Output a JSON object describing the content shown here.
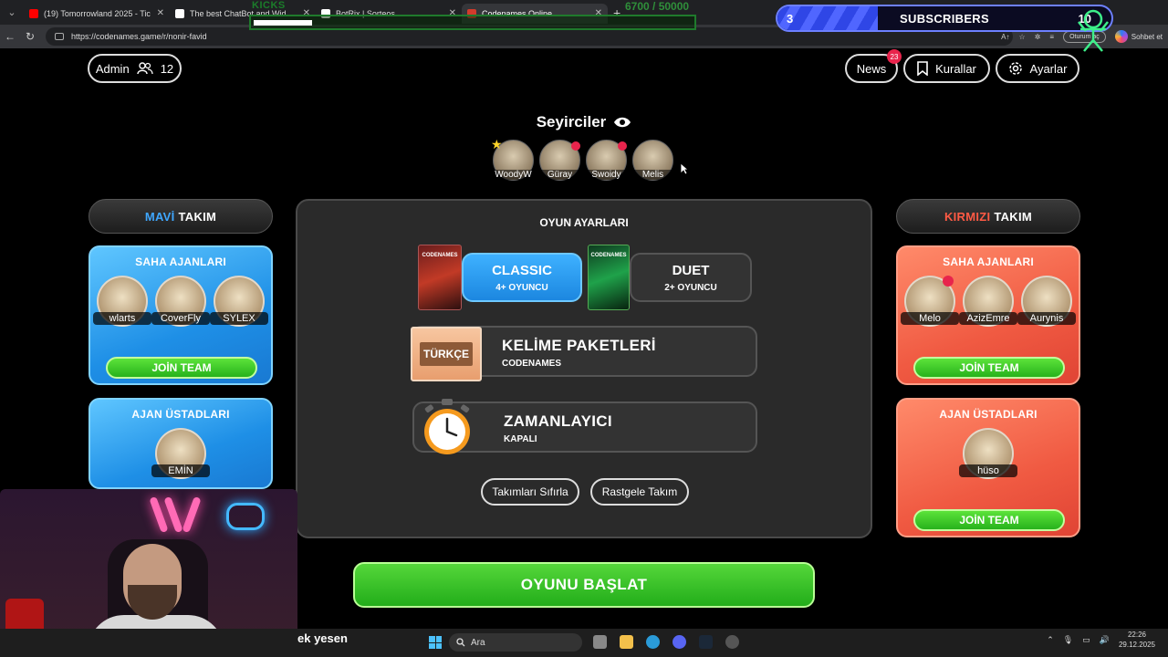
{
  "browser": {
    "tabs": [
      {
        "title": "(19) Tomorrowland 2025 - Tic",
        "color": "#ff0000",
        "active": false
      },
      {
        "title": "The best ChatBot and Widgets for",
        "color": "#ffffff",
        "active": false
      },
      {
        "title": "BotRix | Sorteos",
        "color": "#ffffff",
        "active": false
      },
      {
        "title": "Codenames Online",
        "color": "#d23b2c",
        "active": true
      }
    ],
    "url": "https://codenames.game/r/nonir-favid",
    "login_label": "Oturum aç",
    "chat_label": "Sohbet et"
  },
  "overlays": {
    "kicks_label": "KICKS",
    "kicks_progress": 0.134,
    "kicks_count": "6700  / 50000",
    "subs_current": "3",
    "subs_label": "SUBSCRIBERS",
    "subs_goal": "10",
    "subs_progress": 0.3
  },
  "header": {
    "admin_label": "Admin",
    "player_count": "12",
    "news_label": "News",
    "news_badge": "23",
    "rules_label": "Kurallar",
    "settings_label": "Ayarlar"
  },
  "spectators": {
    "title": "Seyirciler",
    "list": [
      {
        "name": "WoodyW"
      },
      {
        "name": "Güray"
      },
      {
        "name": "Swoidy"
      },
      {
        "name": "Melis"
      }
    ]
  },
  "blue_team": {
    "header_color_word": "MAVİ",
    "header_rest": "TAKIM",
    "operatives_title": "SAHA AJANLARI",
    "operatives": [
      "wlarts",
      "CoverFly",
      "SYLEX"
    ],
    "join_label": "JOİN TEAM",
    "spymasters_title": "AJAN ÜSTADLARI",
    "spymasters": [
      "EMİN"
    ]
  },
  "red_team": {
    "header_color_word": "KIRMIZI",
    "header_rest": "TAKIM",
    "operatives_title": "SAHA AJANLARI",
    "operatives": [
      "Melo",
      "AzizEmre",
      "Aurynis"
    ],
    "join_label": "JOİN TEAM",
    "spymasters_title": "AJAN ÜSTADLARI",
    "spymasters": [
      "hüso"
    ],
    "join_label_2": "JOİN TEAM"
  },
  "settings": {
    "title": "OYUN AYARLARI",
    "mode_classic": "CLASSIC",
    "mode_classic_sub": "4+ OYUNCU",
    "mode_duet": "DUET",
    "mode_duet_sub": "2+ OYUNCU",
    "box_label": "CODENAMES",
    "wordpack_title": "KELİME PAKETLERİ",
    "wordpack_sub": "CODENAMES",
    "wordpack_lang": "TÜRKÇE",
    "timer_title": "ZAMANLAYICI",
    "timer_sub": "KAPALI",
    "reset_teams": "Takımları Sıfırla",
    "random_teams": "Rastgele Takım"
  },
  "start_label": "OYUNU BAŞLAT",
  "taskbar": {
    "stream_text": "ek yesen",
    "search_placeholder": "Ara",
    "time": "22:26",
    "date": "29.12.2025"
  },
  "colors": {
    "blue_accent": "#3fa7ff",
    "red_accent": "#ff5a44",
    "join_green": "#27b21c",
    "badge_red": "#e8244c"
  }
}
